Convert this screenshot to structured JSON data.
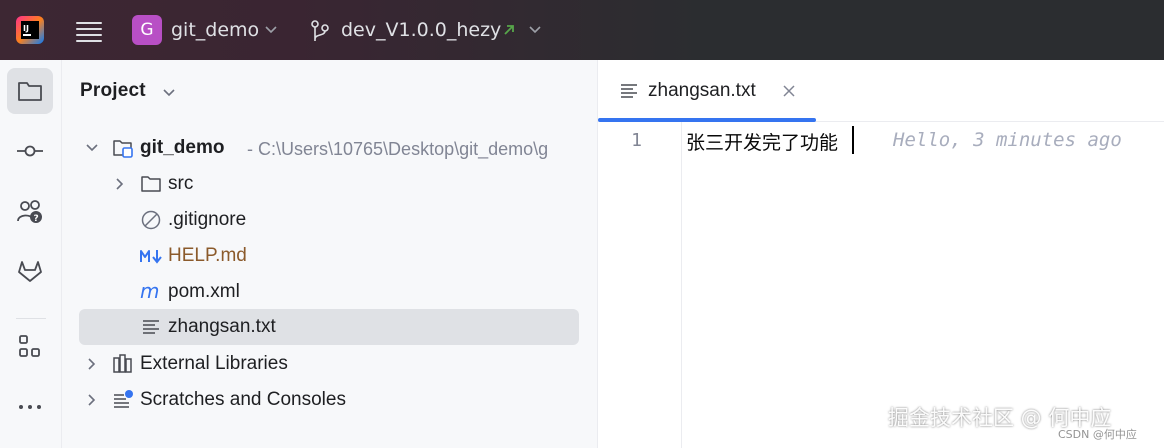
{
  "titlebar": {
    "project_initial": "G",
    "project_name": "git_demo",
    "branch_name": "dev_V1.0.0_hezy"
  },
  "sidebar": {
    "tools": [
      "project",
      "commit",
      "pull-requests",
      "gitlab",
      "structure",
      "more"
    ]
  },
  "project_panel": {
    "title": "Project",
    "tree": [
      {
        "label": "git_demo",
        "path": "- C:\\Users\\10765\\Desktop\\git_demo\\g"
      },
      {
        "label": "src"
      },
      {
        "label": ".gitignore"
      },
      {
        "label": "HELP.md"
      },
      {
        "label": "pom.xml"
      },
      {
        "label": "zhangsan.txt"
      },
      {
        "label": "External Libraries"
      },
      {
        "label": "Scratches and Consoles"
      }
    ]
  },
  "editor": {
    "tab_label": "zhangsan.txt",
    "line_number": "1",
    "line_text": "张三开发完了功能",
    "inlay_blame": "Hello, 3 minutes ago"
  },
  "watermark": {
    "text": "掘金技术社区 @ 何中应",
    "sub": "CSDN @何中应"
  },
  "colors": {
    "accent": "#3574f0",
    "project_badge": "#b84fc5",
    "selection": "#dfe1e5",
    "md_file": "#8b5a2b"
  }
}
